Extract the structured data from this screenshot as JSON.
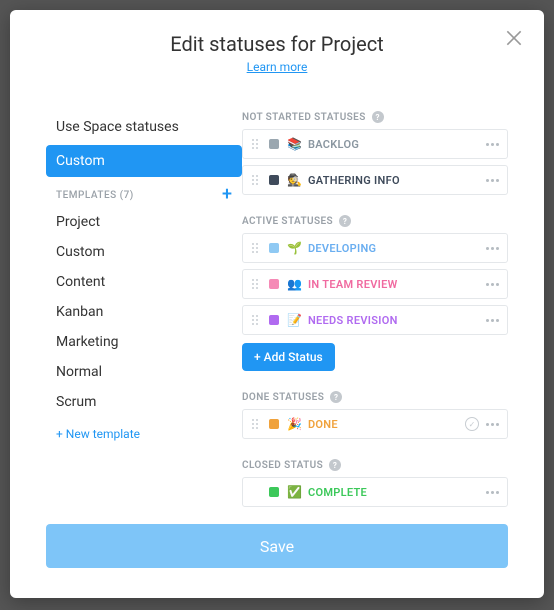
{
  "header": {
    "title": "Edit statuses for Project",
    "learn_more": "Learn more"
  },
  "sidebar": {
    "use_space": "Use Space statuses",
    "custom": "Custom",
    "templates_label": "TEMPLATES (7)",
    "templates": [
      "Project",
      "Custom",
      "Content",
      "Kanban",
      "Marketing",
      "Normal",
      "Scrum"
    ],
    "new_template": "+ New template"
  },
  "groups": {
    "not_started": {
      "title": "NOT STARTED STATUSES",
      "items": [
        {
          "color": "#9aa7b0",
          "emoji": "📚",
          "label": "BACKLOG",
          "labelColor": "#8a96a0"
        },
        {
          "color": "#3f4b5b",
          "emoji": "🕵️",
          "label": "GATHERING INFO",
          "labelColor": "#3f4b5b"
        }
      ]
    },
    "active": {
      "title": "ACTIVE STATUSES",
      "items": [
        {
          "color": "#8fc9f3",
          "emoji": "🌱",
          "label": "DEVELOPING",
          "labelColor": "#6aaef0"
        },
        {
          "color": "#f58ab6",
          "emoji": "👥",
          "label": "IN TEAM REVIEW",
          "labelColor": "#f06aa0"
        },
        {
          "color": "#b06af0",
          "emoji": "📝",
          "label": "NEEDS REVISION",
          "labelColor": "#b06af0"
        }
      ],
      "add": "+ Add Status"
    },
    "done": {
      "title": "DONE STATUSES",
      "items": [
        {
          "color": "#f0a23c",
          "emoji": "🎉",
          "label": "DONE",
          "labelColor": "#f0a23c"
        }
      ]
    },
    "closed": {
      "title": "CLOSED STATUS",
      "item": {
        "color": "#3cc85a",
        "emoji": "✅",
        "label": "COMPLETE",
        "labelColor": "#3cc85a"
      }
    }
  },
  "footer": {
    "save": "Save"
  }
}
